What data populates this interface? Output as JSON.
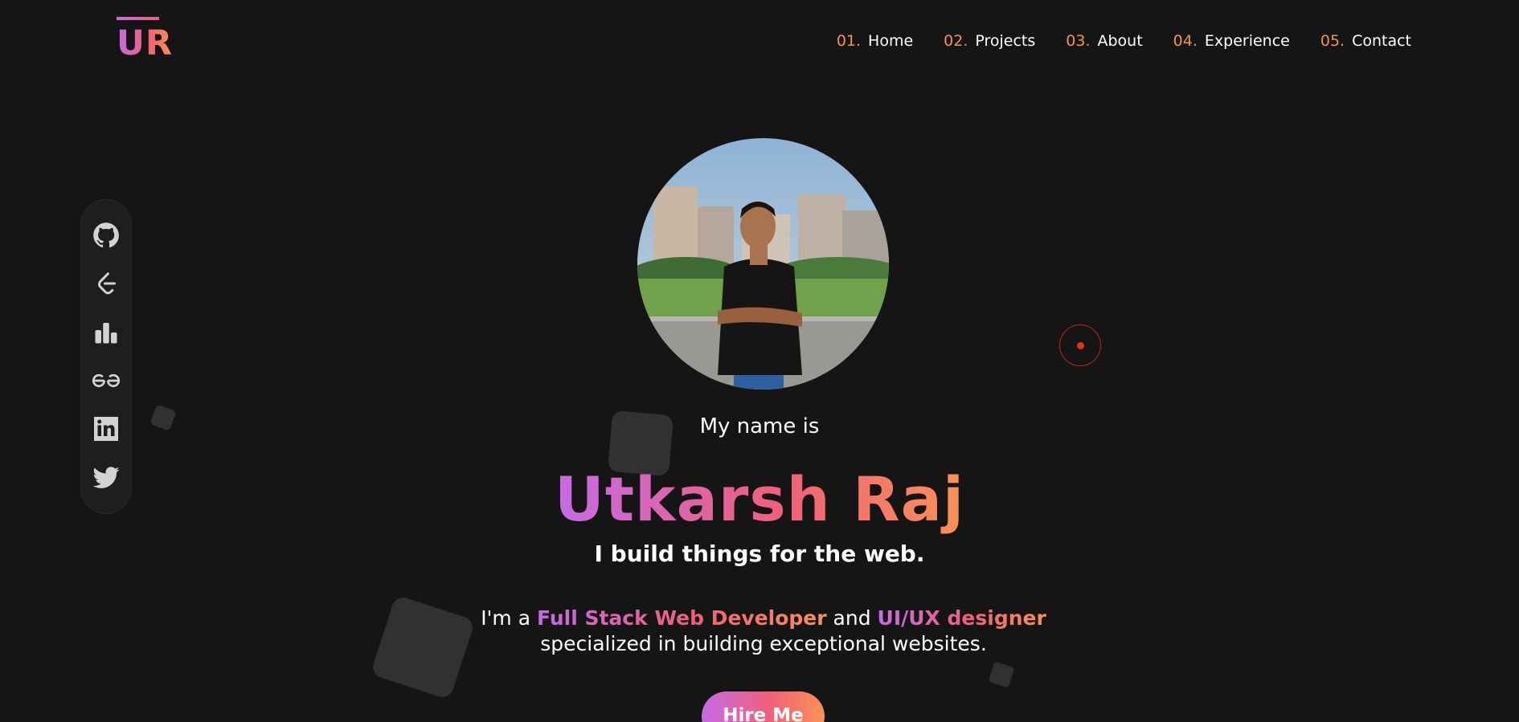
{
  "logo": {
    "text": "UR"
  },
  "nav": {
    "items": [
      {
        "num": "01.",
        "label": "Home"
      },
      {
        "num": "02.",
        "label": "Projects"
      },
      {
        "num": "03.",
        "label": "About"
      },
      {
        "num": "04.",
        "label": "Experience"
      },
      {
        "num": "05.",
        "label": "Contact"
      }
    ]
  },
  "social": {
    "icons": [
      "github-icon",
      "leetcode-icon",
      "codechef-stats-icon",
      "geeksforgeeks-icon",
      "linkedin-icon",
      "twitter-icon"
    ]
  },
  "hero": {
    "intro": "My name is",
    "name": "Utkarsh Raj",
    "tagline": "I build things for the web.",
    "desc_part1": "I'm a ",
    "desc_highlight1": "Full Stack Web Developer",
    "desc_part2": " and ",
    "desc_highlight2": "UI/UX designer",
    "desc_part3": " specialized in building exceptional websites.",
    "cta": "Hire Me"
  },
  "colors": {
    "background": "#161515",
    "accent_orange": "#f0944e",
    "gradient_start": "#c56be6",
    "gradient_mid": "#f0607a",
    "gradient_end": "#f99257",
    "red_dot": "#e5301c"
  }
}
